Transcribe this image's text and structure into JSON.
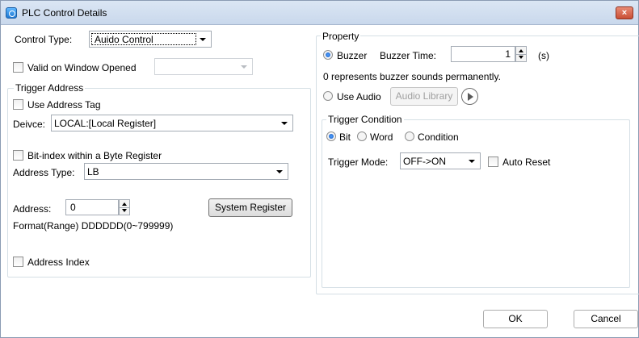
{
  "window": {
    "title": "PLC Control Details",
    "close_glyph": "×"
  },
  "left": {
    "control_type_label": "Control Type:",
    "control_type_value": "Auido Control",
    "valid_window_label": "Valid on Window Opened",
    "valid_window_value": "",
    "trigger_address": {
      "title": "Trigger Address",
      "use_tag_label": "Use Address Tag",
      "device_label": "Deivce:",
      "device_value": "LOCAL:[Local Register]",
      "bit_index_label": "Bit-index within a Byte Register",
      "address_type_label": "Address Type:",
      "address_type_value": "LB",
      "address_label": "Address:",
      "address_value": "0",
      "system_register_button": "System Register",
      "format_text": "Format(Range) DDDDDD(0~799999)",
      "address_index_label": "Address Index"
    }
  },
  "property": {
    "title": "Property",
    "buzzer_label": "Buzzer",
    "buzzer_time_label": "Buzzer Time:",
    "buzzer_time_value": "1",
    "buzzer_unit": "(s)",
    "buzzer_note": "0 represents buzzer sounds permanently.",
    "use_audio_label": "Use Audio",
    "audio_library_button": "Audio Library",
    "trigger_condition": {
      "title": "Trigger Condition",
      "options": [
        "Bit",
        "Word",
        "Condition"
      ],
      "selected": "Bit",
      "mode_label": "Trigger Mode:",
      "mode_value": "OFF->ON",
      "auto_reset_label": "Auto Reset"
    }
  },
  "footer": {
    "ok_label": "OK",
    "cancel_label": "Cancel"
  },
  "icons": {
    "app": "plc-app-icon",
    "close": "close-icon",
    "play": "play-icon"
  },
  "colors": {
    "titlebar": "#c9d8ec",
    "close_button": "#c94f35",
    "radio_selected": "#1c5cbf"
  }
}
